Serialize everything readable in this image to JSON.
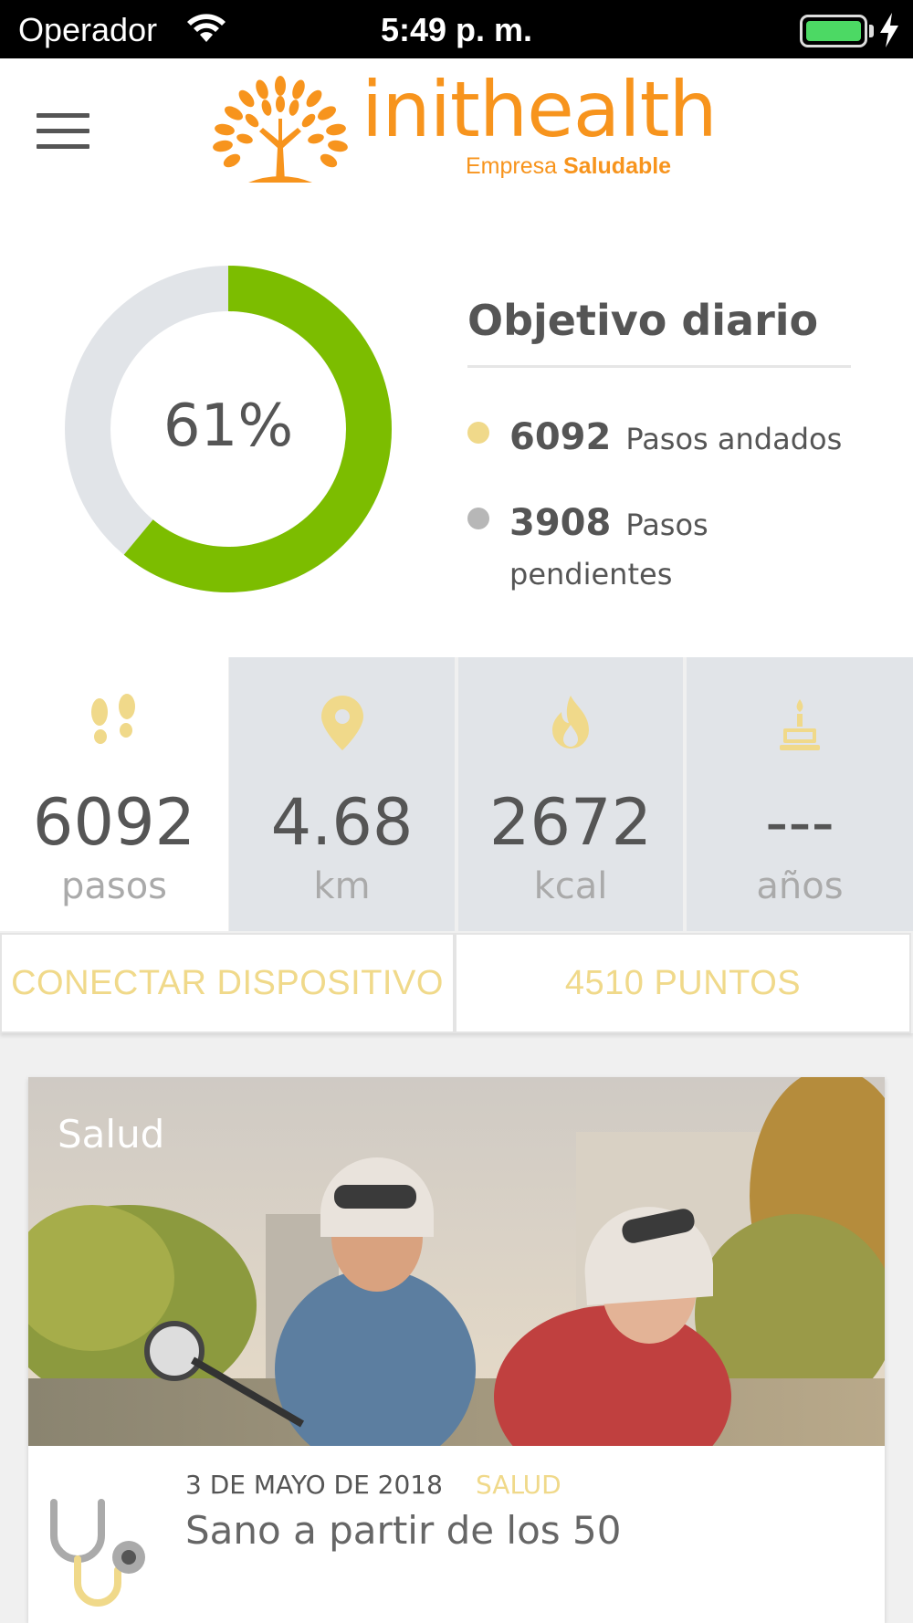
{
  "status_bar": {
    "carrier": "Operador",
    "time": "5:49 p. m."
  },
  "header": {
    "brand_name": "inithealth",
    "tagline_prefix": "Empresa",
    "tagline_bold": "Saludable",
    "brand_color": "#f7941d"
  },
  "goal": {
    "percent": 61,
    "percent_label": "61%",
    "title": "Objetivo diario",
    "walked_value": "6092",
    "walked_label": "Pasos andados",
    "pending_value": "3908",
    "pending_label": "Pasos pendientes",
    "progress_color": "#7cbd00",
    "track_color": "#e1e4e8",
    "walked_dot_color": "#f0d98a",
    "pending_dot_color": "#b7b7b7"
  },
  "stats": [
    {
      "icon": "footsteps-icon",
      "value": "6092",
      "unit": "pasos"
    },
    {
      "icon": "location-pin-icon",
      "value": "4.68",
      "unit": "km"
    },
    {
      "icon": "flame-icon",
      "value": "2672",
      "unit": "kcal"
    },
    {
      "icon": "birthday-cake-icon",
      "value": "---",
      "unit": "años"
    }
  ],
  "actions": {
    "connect_device": "CONECTAR DISPOSITIVO",
    "points": "4510 PUNTOS"
  },
  "article": {
    "image_tag": "Salud",
    "date": "3 DE MAYO DE 2018",
    "category": "SALUD",
    "title": "Sano a partir de los 50",
    "icon": "stethoscope-icon"
  },
  "accent_color": "#f0d98a"
}
